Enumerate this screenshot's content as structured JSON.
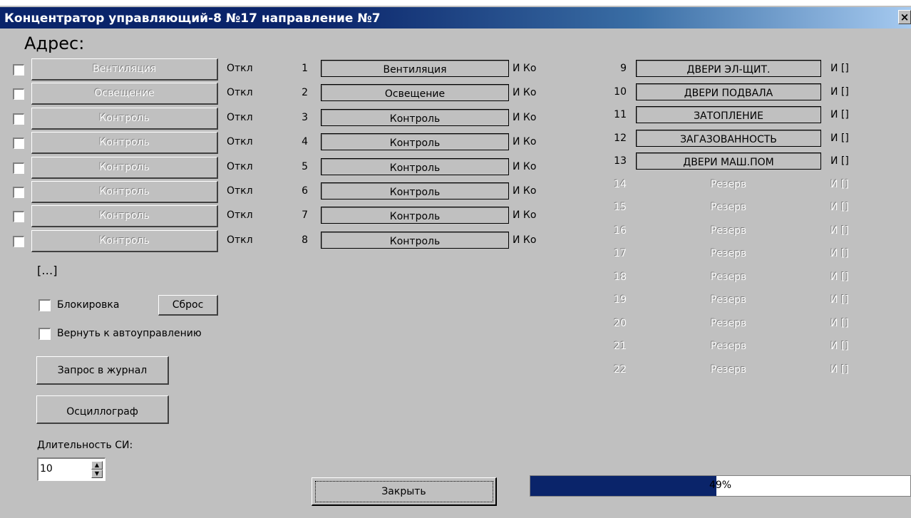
{
  "window": {
    "title": "Концентратор управляющий-8 №17 направление №7",
    "close_label": "×"
  },
  "address_label": "Адрес:",
  "left_rows": [
    {
      "label": "Вентиляция",
      "state": "Откл"
    },
    {
      "label": "Освещение",
      "state": "Откл"
    },
    {
      "label": "Контроль",
      "state": "Откл"
    },
    {
      "label": "Контроль",
      "state": "Откл"
    },
    {
      "label": "Контроль",
      "state": "Откл"
    },
    {
      "label": "Контроль",
      "state": "Откл"
    },
    {
      "label": "Контроль",
      "state": "Откл"
    },
    {
      "label": "Контроль",
      "state": "Откл"
    }
  ],
  "channels_a": [
    {
      "num": "1",
      "label": "Вентиляция",
      "status": "И Ко"
    },
    {
      "num": "2",
      "label": "Освещение",
      "status": "И Ко"
    },
    {
      "num": "3",
      "label": "Контроль",
      "status": "И Ко"
    },
    {
      "num": "4",
      "label": "Контроль",
      "status": "И Ко"
    },
    {
      "num": "5",
      "label": "Контроль",
      "status": "И Ко"
    },
    {
      "num": "6",
      "label": "Контроль",
      "status": "И Ко"
    },
    {
      "num": "7",
      "label": "Контроль",
      "status": "И Ко"
    },
    {
      "num": "8",
      "label": "Контроль",
      "status": "И Ко"
    }
  ],
  "channels_b": [
    {
      "num": "9",
      "label": "ДВЕРИ ЭЛ-ЩИТ.",
      "status": "И []"
    },
    {
      "num": "10",
      "label": "ДВЕРИ ПОДВАЛА",
      "status": "И []"
    },
    {
      "num": "11",
      "label": "ЗАТОПЛЕНИЕ",
      "status": "И []"
    },
    {
      "num": "12",
      "label": "ЗАГАЗОВАННОСТЬ",
      "status": "И []"
    },
    {
      "num": "13",
      "label": "ДВЕРИ МАШ.ПОМ",
      "status": "И []"
    },
    {
      "num": "14",
      "label": "Резерв",
      "status": "И []"
    },
    {
      "num": "15",
      "label": "Резерв",
      "status": "И []"
    },
    {
      "num": "16",
      "label": "Резерв",
      "status": "И []"
    },
    {
      "num": "17",
      "label": "Резерв",
      "status": "И []"
    },
    {
      "num": "18",
      "label": "Резерв",
      "status": "И []"
    },
    {
      "num": "19",
      "label": "Резерв",
      "status": "И []"
    },
    {
      "num": "20",
      "label": "Резерв",
      "status": "И []"
    },
    {
      "num": "21",
      "label": "Резерв",
      "status": "И []"
    },
    {
      "num": "22",
      "label": "Резерв",
      "status": "И []"
    }
  ],
  "ellipsis": "[…]",
  "block_label": "Блокировка",
  "reset_label": "Сброс",
  "auto_label": "Вернуть к автоуправлению",
  "journal_label": "Запрос в журнал",
  "osc_label": "Осциллограф",
  "duration_label": "Длительность СИ:",
  "duration_value": "10",
  "close_label": "Закрыть",
  "progress": {
    "percent": 49,
    "text": "49%"
  }
}
